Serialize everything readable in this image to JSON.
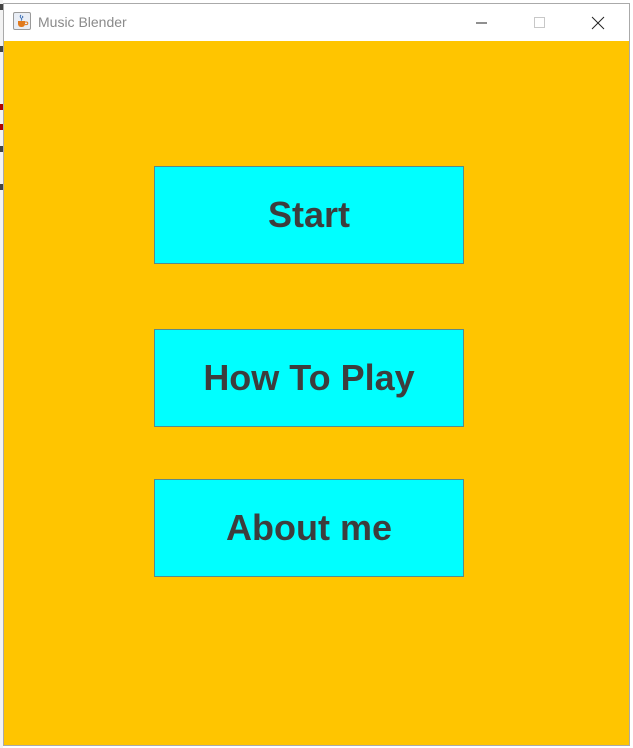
{
  "window": {
    "title": "Music Blender",
    "app_icon": "java-coffee-icon",
    "controls": [
      "minimize-icon",
      "maximize-icon",
      "close-icon"
    ]
  },
  "menu": {
    "start_label": "Start",
    "how_to_play_label": "How To Play",
    "about_label": "About me"
  },
  "colors": {
    "background": "#ffc500",
    "button_fill": "#00ffff",
    "button_text": "#3d3d3d"
  }
}
